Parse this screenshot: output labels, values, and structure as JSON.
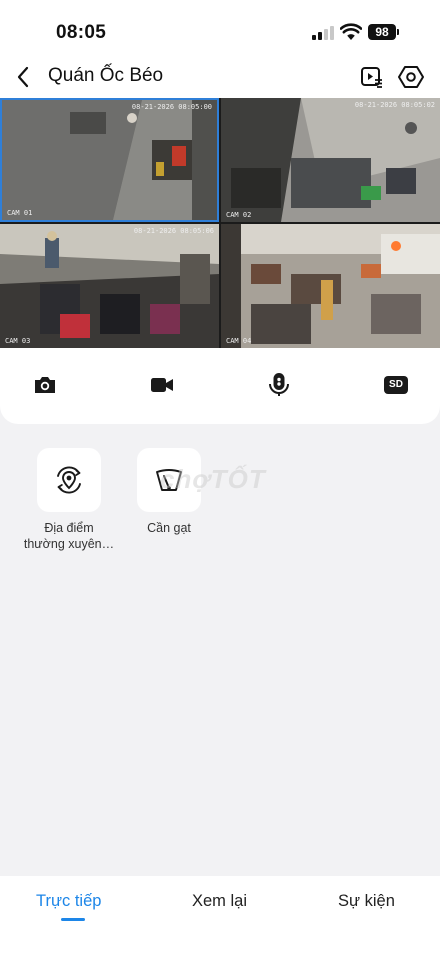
{
  "status_bar": {
    "time": "08:05",
    "battery": "98"
  },
  "header": {
    "title": "Quán Ốc Béo"
  },
  "cameras": [
    {
      "label": "CAM 01",
      "timestamp": "08-21-2026 08:05:00"
    },
    {
      "label": "CAM 02",
      "timestamp": "08-21-2026 08:05:02"
    },
    {
      "label": "CAM 03",
      "timestamp": "08-21-2026 08:05:06"
    },
    {
      "label": "CAM 04",
      "timestamp": ""
    }
  ],
  "controls": {
    "sd_label": "SD"
  },
  "shortcuts": [
    {
      "label": "Địa điểm thường xuyên…",
      "icon": "location-rotate-icon"
    },
    {
      "label": "Cần gạt",
      "icon": "wiper-icon"
    }
  ],
  "watermark": "chợTỐT",
  "tabs": [
    {
      "label": "Trực tiếp",
      "active": true
    },
    {
      "label": "Xem lại",
      "active": false
    },
    {
      "label": "Sự kiện",
      "active": false
    }
  ],
  "colors": {
    "accent": "#1d86e8",
    "selected_border": "#2f7fd8"
  }
}
